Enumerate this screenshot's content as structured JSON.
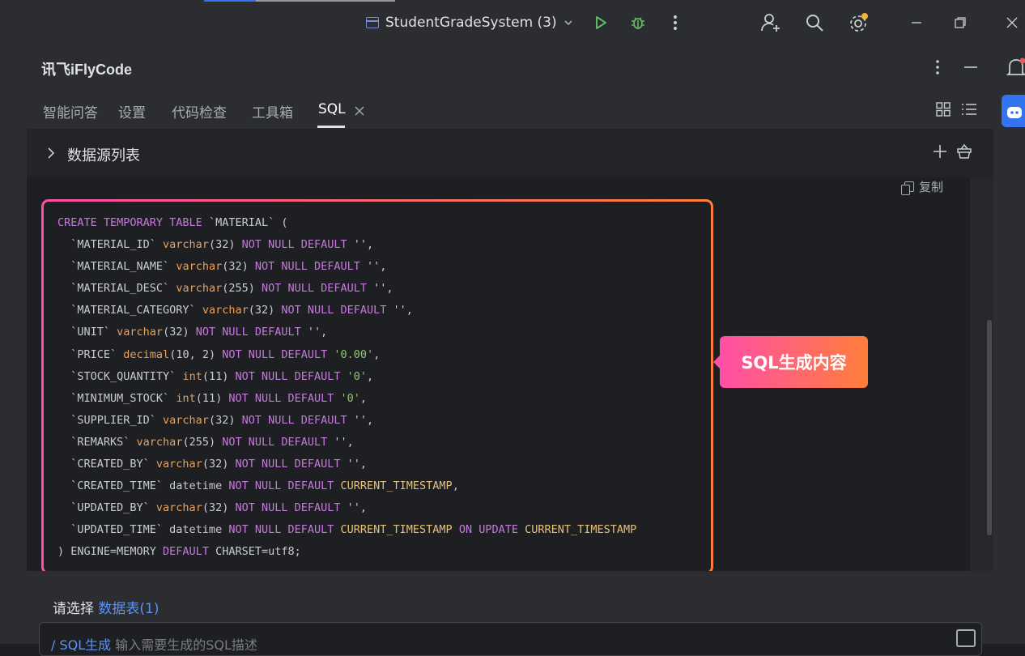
{
  "titlebar": {
    "project_name": "StudentGradeSystem (3)",
    "colors": {
      "accent": "#3574f0",
      "run": "#5fb865",
      "badge": "#f2b53c"
    }
  },
  "plugin": {
    "title": "讯飞iFlyCode",
    "tabs": [
      {
        "label": "智能问答"
      },
      {
        "label": "设置"
      },
      {
        "label": "代码检查"
      },
      {
        "label": "工具箱"
      },
      {
        "label": "SQL"
      }
    ],
    "active_tab": "SQL"
  },
  "datasource": {
    "title": "数据源列表"
  },
  "code_panel": {
    "copy_label": "复制",
    "lines": [
      [
        {
          "t": "CREATE TEMPORARY TABLE",
          "c": "kw"
        },
        {
          "t": " `MATERIAL` (",
          "c": ""
        }
      ],
      [
        {
          "t": "  `MATERIAL_ID` ",
          "c": ""
        },
        {
          "t": "varchar",
          "c": "ty"
        },
        {
          "t": "(32) ",
          "c": ""
        },
        {
          "t": "NOT NULL DEFAULT",
          "c": "kw"
        },
        {
          "t": " '',",
          "c": ""
        }
      ],
      [
        {
          "t": "  `MATERIAL_NAME` ",
          "c": ""
        },
        {
          "t": "varchar",
          "c": "ty"
        },
        {
          "t": "(32) ",
          "c": ""
        },
        {
          "t": "NOT NULL DEFAULT",
          "c": "kw"
        },
        {
          "t": " '',",
          "c": ""
        }
      ],
      [
        {
          "t": "  `MATERIAL_DESC` ",
          "c": ""
        },
        {
          "t": "varchar",
          "c": "ty"
        },
        {
          "t": "(255) ",
          "c": ""
        },
        {
          "t": "NOT NULL DEFAULT",
          "c": "kw"
        },
        {
          "t": " '',",
          "c": ""
        }
      ],
      [
        {
          "t": "  `MATERIAL_CATEGORY` ",
          "c": ""
        },
        {
          "t": "varchar",
          "c": "ty"
        },
        {
          "t": "(32) ",
          "c": ""
        },
        {
          "t": "NOT NULL DEFAULT",
          "c": "kw"
        },
        {
          "t": " '',",
          "c": ""
        }
      ],
      [
        {
          "t": "  `UNIT` ",
          "c": ""
        },
        {
          "t": "varchar",
          "c": "ty"
        },
        {
          "t": "(32) ",
          "c": ""
        },
        {
          "t": "NOT NULL DEFAULT",
          "c": "kw"
        },
        {
          "t": " '',",
          "c": ""
        }
      ],
      [
        {
          "t": "  `PRICE` ",
          "c": ""
        },
        {
          "t": "decimal",
          "c": "ty"
        },
        {
          "t": "(10, 2) ",
          "c": ""
        },
        {
          "t": "NOT NULL DEFAULT",
          "c": "kw"
        },
        {
          "t": " ",
          "c": ""
        },
        {
          "t": "'0.00'",
          "c": "st"
        },
        {
          "t": ",",
          "c": ""
        }
      ],
      [
        {
          "t": "  `STOCK_QUANTITY` ",
          "c": ""
        },
        {
          "t": "int",
          "c": "ty"
        },
        {
          "t": "(11) ",
          "c": ""
        },
        {
          "t": "NOT NULL DEFAULT",
          "c": "kw"
        },
        {
          "t": " ",
          "c": ""
        },
        {
          "t": "'0'",
          "c": "st"
        },
        {
          "t": ",",
          "c": ""
        }
      ],
      [
        {
          "t": "  `MINIMUM_STOCK` ",
          "c": ""
        },
        {
          "t": "int",
          "c": "ty"
        },
        {
          "t": "(11) ",
          "c": ""
        },
        {
          "t": "NOT NULL DEFAULT",
          "c": "kw"
        },
        {
          "t": " ",
          "c": ""
        },
        {
          "t": "'0'",
          "c": "st"
        },
        {
          "t": ",",
          "c": ""
        }
      ],
      [
        {
          "t": "  `SUPPLIER_ID` ",
          "c": ""
        },
        {
          "t": "varchar",
          "c": "ty"
        },
        {
          "t": "(32) ",
          "c": ""
        },
        {
          "t": "NOT NULL DEFAULT",
          "c": "kw"
        },
        {
          "t": " '',",
          "c": ""
        }
      ],
      [
        {
          "t": "  `REMARKS` ",
          "c": ""
        },
        {
          "t": "varchar",
          "c": "ty"
        },
        {
          "t": "(255) ",
          "c": ""
        },
        {
          "t": "NOT NULL DEFAULT",
          "c": "kw"
        },
        {
          "t": " '',",
          "c": ""
        }
      ],
      [
        {
          "t": "  `CREATED_BY` ",
          "c": ""
        },
        {
          "t": "varchar",
          "c": "ty"
        },
        {
          "t": "(32) ",
          "c": ""
        },
        {
          "t": "NOT NULL DEFAULT",
          "c": "kw"
        },
        {
          "t": " '',",
          "c": ""
        }
      ],
      [
        {
          "t": "  `CREATED_TIME` datetime ",
          "c": ""
        },
        {
          "t": "NOT NULL DEFAULT",
          "c": "kw"
        },
        {
          "t": " ",
          "c": ""
        },
        {
          "t": "CURRENT_TIMESTAMP",
          "c": "fn"
        },
        {
          "t": ",",
          "c": ""
        }
      ],
      [
        {
          "t": "  `UPDATED_BY` ",
          "c": ""
        },
        {
          "t": "varchar",
          "c": "ty"
        },
        {
          "t": "(32) ",
          "c": ""
        },
        {
          "t": "NOT NULL DEFAULT",
          "c": "kw"
        },
        {
          "t": " '',",
          "c": ""
        }
      ],
      [
        {
          "t": "  `UPDATED_TIME` datetime ",
          "c": ""
        },
        {
          "t": "NOT NULL DEFAULT",
          "c": "kw"
        },
        {
          "t": " ",
          "c": ""
        },
        {
          "t": "CURRENT_TIMESTAMP",
          "c": "fn"
        },
        {
          "t": " ",
          "c": ""
        },
        {
          "t": "ON UPDATE",
          "c": "kw"
        },
        {
          "t": " ",
          "c": ""
        },
        {
          "t": "CURRENT_TIMESTAMP",
          "c": "fn"
        }
      ],
      [
        {
          "t": ") ENGINE=MEMORY ",
          "c": ""
        },
        {
          "t": "DEFAULT",
          "c": "kw"
        },
        {
          "t": " CHARSET=utf8;",
          "c": ""
        }
      ]
    ]
  },
  "callout": {
    "label": "SQL生成内容"
  },
  "bottom": {
    "choose_label": "请选择",
    "choose_link": "数据表(1)",
    "input_tag": "/ SQL生成",
    "input_placeholder": "输入需要生成的SQL描述"
  }
}
